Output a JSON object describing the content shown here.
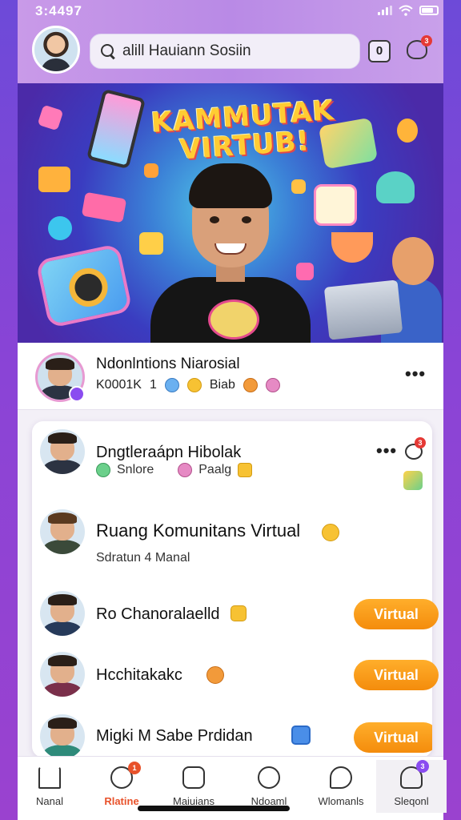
{
  "status_bar": {
    "time": "3:4497"
  },
  "header": {
    "search_text": "alill Hauiann Sosiin",
    "zero_button_label": "0",
    "bell_badge": "3"
  },
  "banner": {
    "title_line1": "KAMMUTAK",
    "title_line2": "VIRTUB!"
  },
  "featured": {
    "name": "Ndonlntions Niarosial",
    "sub_text": "K0001K",
    "sub_num": "1",
    "sub_label": "Biab"
  },
  "list": {
    "items": [
      {
        "name": "Dngtleraápn Hibolak",
        "sub1": "Snlore",
        "sub2": "Paalg",
        "badge": "3"
      },
      {
        "name": "Ruang Komunitans Virtual",
        "sub1": "Sdratun 4 Manal"
      },
      {
        "name": "Ro Chanoralaelld",
        "button": "Virtual"
      },
      {
        "name": "Hcchitakakc",
        "button": "Virtual"
      },
      {
        "name": "Migki M Sabe Prdidan",
        "button": "Virtual"
      }
    ]
  },
  "nav": {
    "items": [
      {
        "label": "Nanal"
      },
      {
        "label": "Rlatine",
        "badge": "1"
      },
      {
        "label": "Maiuians"
      },
      {
        "label": "Ndoaml"
      },
      {
        "label": "Wlomanls"
      },
      {
        "label": "Sleqonl",
        "badge": "3"
      }
    ]
  },
  "colors": {
    "accent_orange": "#f59410",
    "purple_bg": "#7b45d6",
    "badge_red": "#e53935"
  }
}
